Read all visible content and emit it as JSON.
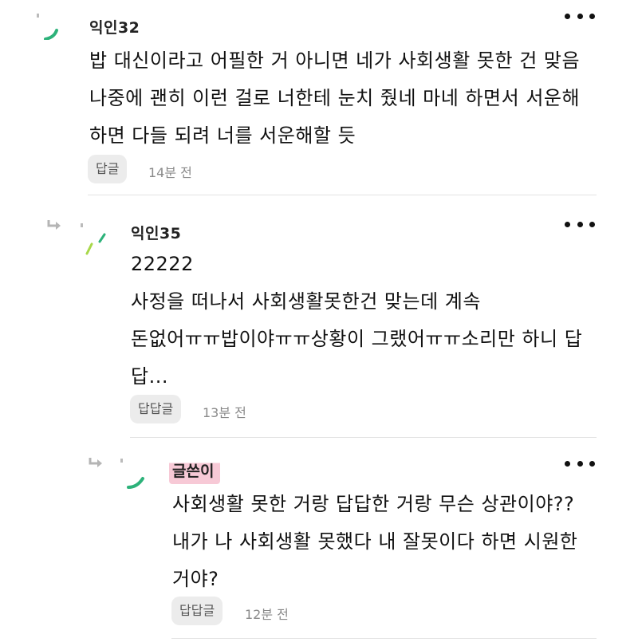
{
  "comments": [
    {
      "author": "익인32",
      "text": "밥 대신이라고 어필한 거 아니면 네가 사회생활 못한 건 맞음\n나중에 괜히 이런 걸로 너한테 눈치 줬네 마네 하면서 서운해\n하면 다들 되려 너를 서운해할 듯",
      "reply_label": "답글",
      "time": "14분 전"
    },
    {
      "author": "익인35",
      "text": "22222\n사정을 떠나서 사회생활못한건 맞는데 계속\n돈없어ㅠㅠ밥이야ㅠㅠ상황이 그랬어ㅠㅠ소리만 하니 답\n답...",
      "reply_label": "답답글",
      "time": "13분 전"
    },
    {
      "author": "글쓴이",
      "text": "사회생활 못한 거랑 답답한 거랑 무슨 상관이야??\n내가 나 사회생활 못했다 내 잘못이다 하면 시원한\n거야?",
      "reply_label": "답답글",
      "time": "12분 전"
    }
  ],
  "colors": {
    "avatar_accent": "#2db27a",
    "avatar_accent_light": "#a8d84a",
    "op_highlight": "#f7c9d6",
    "divider": "#e3e3e3"
  },
  "icons": {
    "more": "more-dots-icon",
    "reply_arrow": "reply-arrow-icon",
    "avatar": "avatar-icon"
  }
}
